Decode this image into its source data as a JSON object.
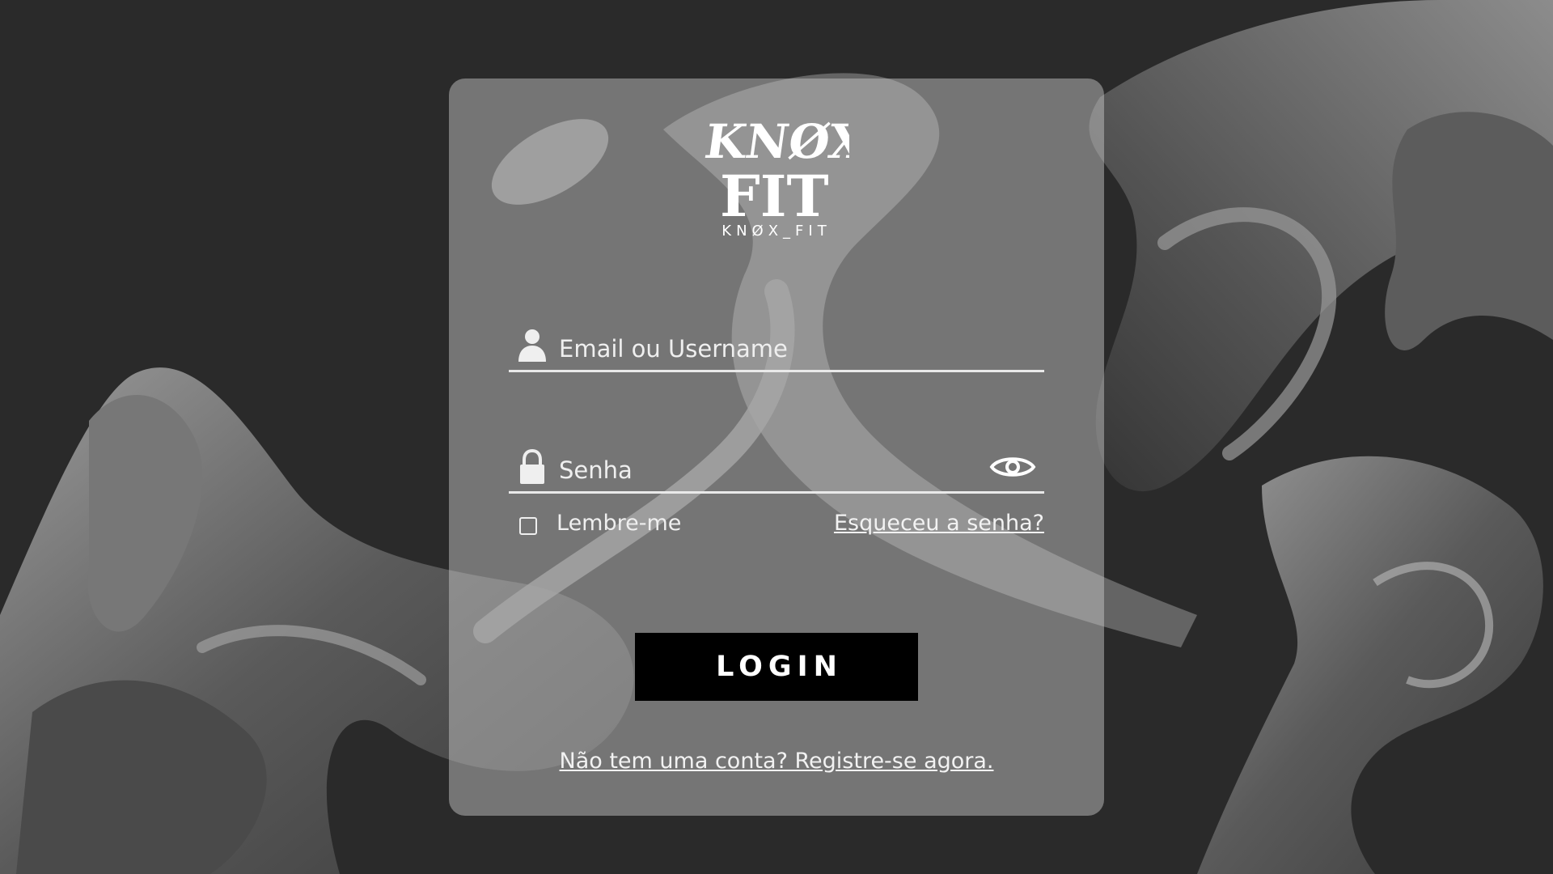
{
  "brand": {
    "name": "KNØX_FIT",
    "logo_text": "KNØX FIT"
  },
  "form": {
    "email_placeholder": "Email ou Username",
    "password_placeholder": "Senha",
    "remember_label": "Lembre-me",
    "forgot_link": "Esqueceu a senha?",
    "login_button": "LOGIN",
    "register_link": "Não tem uma conta? Registre-se agora."
  },
  "icons": {
    "email": "user-icon",
    "password": "lock-icon",
    "toggle_password": "eye-icon"
  },
  "colors": {
    "background": "#2a2a2a",
    "card": "#c8c8c8",
    "button": "#000000",
    "text": "#ffffff"
  }
}
